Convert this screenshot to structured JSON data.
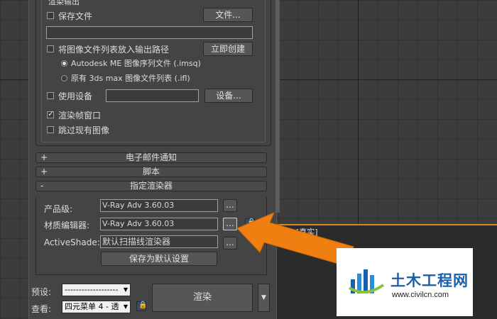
{
  "viewport": {
    "label": "[真实]"
  },
  "output_group": {
    "title": "渲染输出",
    "save_file": {
      "label": "保存文件",
      "checked": false
    },
    "files_button": "文件...",
    "path_value": "",
    "put_list": {
      "label": "将图像文件列表放入输出路径",
      "checked": false
    },
    "create_now": "立即创建",
    "radio_autodesk": {
      "label": "Autodesk ME 图像序列文件 (.imsq)",
      "selected": true
    },
    "radio_legacy": {
      "label": "原有 3ds max 图像文件列表 (.ifl)",
      "selected": false
    },
    "use_device": {
      "label": "使用设备",
      "checked": false
    },
    "device_value": "",
    "devices_button": "设备...",
    "render_frame_window": {
      "label": "渲染帧窗口",
      "checked": true
    },
    "skip_existing": {
      "label": "跳过现有图像",
      "checked": false
    }
  },
  "rollouts": [
    {
      "sign": "+",
      "title": "电子邮件通知"
    },
    {
      "sign": "+",
      "title": "脚本"
    },
    {
      "sign": "-",
      "title": "指定渲染器"
    }
  ],
  "assign": {
    "production_label": "产品级:",
    "production_value": "V-Ray Adv 3.60.03",
    "material_label": "材质编辑器:",
    "material_value": "V-Ray Adv 3.60.03",
    "activeshade_label": "ActiveShade:",
    "activeshade_value": "默认扫描线渲染器",
    "browse": "...",
    "save_default": "保存为默认设置"
  },
  "bottom": {
    "preset_label": "预设:",
    "preset_value": "-------------------",
    "view_label": "查看:",
    "view_value": "四元菜单 4 - 透",
    "render_button": "渲染",
    "render_arrow": "▼"
  },
  "watermark": {
    "name": "土木工程网",
    "url": "www.civilcn.com"
  },
  "colors": {
    "arrow": "#f07f12",
    "logo_blue": "#1c5fae"
  }
}
